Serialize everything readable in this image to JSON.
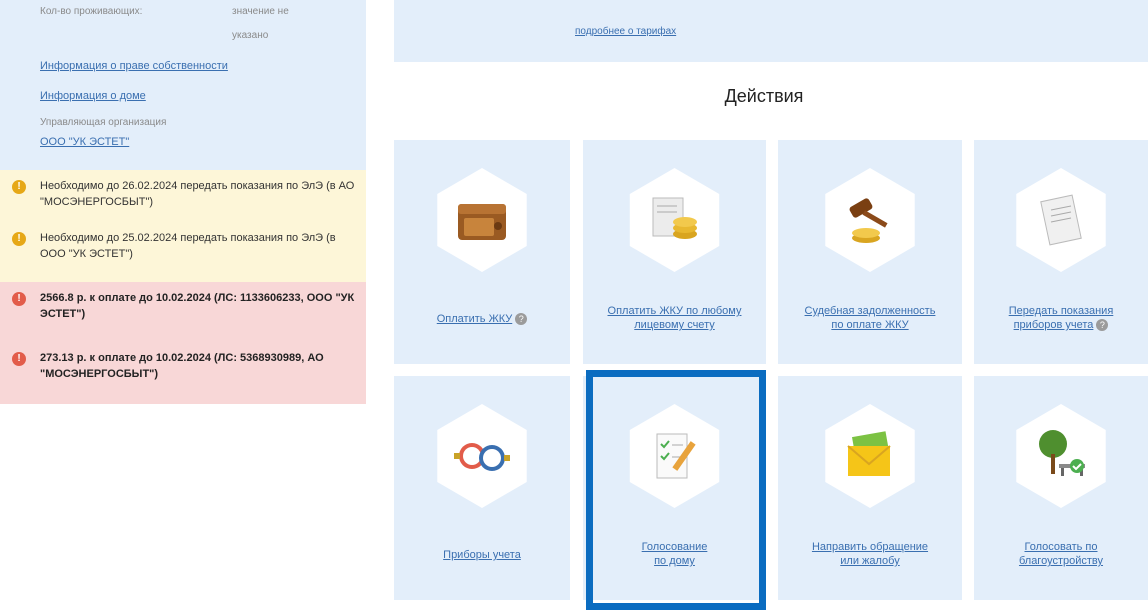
{
  "sidebar": {
    "residents_label": "Кол-во проживающих:",
    "residents_value_1": "значение не",
    "residents_value_2": "указано",
    "ownership_link": "Информация о праве собственности",
    "house_link": "Информация о доме",
    "management_label": "Управляющая организация",
    "management_link": "ООО \"УК ЭСТЕТ\"",
    "notices": [
      {
        "icon": "exclamation-icon",
        "text": "Необходимо до 26.02.2024 передать показания по ЭлЭ (в АО \"МОСЭНЕРГОСБЫТ\")"
      },
      {
        "icon": "exclamation-icon",
        "text": "Необходимо до 25.02.2024 передать показания по ЭлЭ (в ООО \"УК ЭСТЕТ\")"
      },
      {
        "icon": "exclamation-icon",
        "text": "2566.8 р. к оплате до 10.02.2024 (ЛС: 1133606233, ООО \"УК ЭСТЕТ\")"
      },
      {
        "icon": "exclamation-icon",
        "text": "273.13 р. к оплате до 10.02.2024 (ЛС: 5368930989, АО \"МОСЭНЕРГОСБЫТ\")"
      }
    ]
  },
  "tariff_link": "подробнее о тарифах",
  "actions_title": "Действия",
  "tiles": [
    {
      "label_1": "Оплатить ЖКУ",
      "label_2": "",
      "help": "?",
      "icon": "wallet-icon"
    },
    {
      "label_1": "Оплатить ЖКУ по любому",
      "label_2": "лицевому счету",
      "help": "",
      "icon": "coins-document-icon"
    },
    {
      "label_1": "Судебная задолженность",
      "label_2": "по оплате ЖКУ",
      "help": "",
      "icon": "gavel-icon"
    },
    {
      "label_1": "Передать показания",
      "label_2": "приборов учета",
      "help": "?",
      "icon": "document-icon"
    },
    {
      "label_1": "Приборы учета",
      "label_2": "",
      "help": "",
      "icon": "water-meter-icon"
    },
    {
      "label_1": "Голосование",
      "label_2": "по дому",
      "help": "",
      "icon": "checklist-pencil-icon"
    },
    {
      "label_1": "Направить обращение",
      "label_2": "или жалобу",
      "help": "",
      "icon": "envelope-icon"
    },
    {
      "label_1": "Голосовать по",
      "label_2": "благоустройству",
      "help": "",
      "icon": "tree-bench-icon"
    }
  ],
  "colors": {
    "accent": "#0b6cc0",
    "tile_bg": "#e3eefa",
    "link": "#3a6fb0"
  }
}
